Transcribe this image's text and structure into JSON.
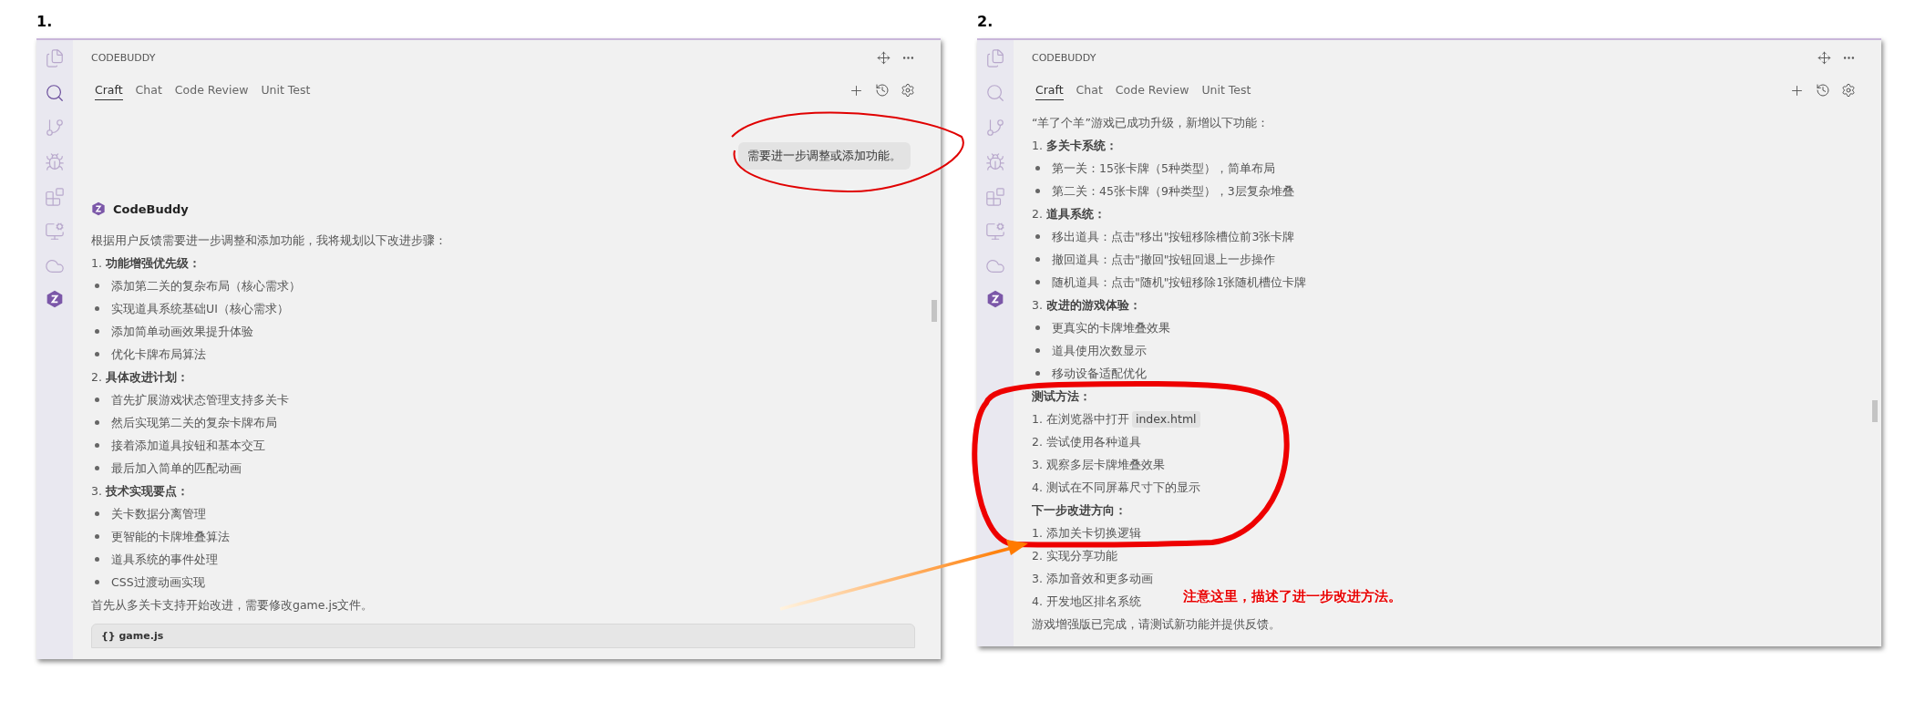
{
  "panels": [
    {
      "label": "1.",
      "header": "CODEBUDDY",
      "tabs": [
        {
          "label": "Craft",
          "selected": true
        },
        {
          "label": "Chat",
          "selected": false
        },
        {
          "label": "Code Review",
          "selected": false
        },
        {
          "label": "Unit Test",
          "selected": false
        }
      ],
      "sidebar": [
        {
          "selected": false
        },
        {
          "selected": true
        },
        {
          "selected": false
        },
        {
          "selected": false
        },
        {
          "selected": false
        },
        {
          "selected": false
        },
        {
          "selected": false
        }
      ],
      "user_message": "需要进一步调整或添加功能。",
      "assistant_name": "CodeBuddy",
      "blocks": [
        {
          "kind": "text",
          "text": "根据用户反馈需要进一步调整和添加功能，我将规划以下改进步骤："
        },
        {
          "kind": "text",
          "text": "1. **功能增强优先级：**"
        },
        {
          "kind": "bullet",
          "text": "添加第二关的复杂布局（核心需求）"
        },
        {
          "kind": "bullet",
          "text": "实现道具系统基础UI（核心需求）"
        },
        {
          "kind": "bullet",
          "text": "添加简单动画效果提升体验"
        },
        {
          "kind": "bullet",
          "text": "优化卡牌布局算法"
        },
        {
          "kind": "text",
          "text": "2. **具体改进计划：**"
        },
        {
          "kind": "bullet",
          "text": "首先扩展游戏状态管理支持多关卡"
        },
        {
          "kind": "bullet",
          "text": "然后实现第二关的复杂卡牌布局"
        },
        {
          "kind": "bullet",
          "text": "接着添加道具按钮和基本交互"
        },
        {
          "kind": "bullet",
          "text": "最后加入简单的匹配动画"
        },
        {
          "kind": "text",
          "text": "3. **技术实现要点：**"
        },
        {
          "kind": "bullet",
          "text": "关卡数据分离管理"
        },
        {
          "kind": "bullet",
          "text": "更智能的卡牌堆叠算法"
        },
        {
          "kind": "bullet",
          "text": "道具系统的事件处理"
        },
        {
          "kind": "bullet",
          "text": "CSS过渡动画实现"
        },
        {
          "kind": "text",
          "text": "首先从多关卡支持开始改进，需要修改game.js文件。"
        },
        {
          "kind": "code_block",
          "text": "{} game.js"
        }
      ]
    },
    {
      "label": "2.",
      "header": "CODEBUDDY",
      "tabs": [
        {
          "label": "Craft",
          "selected": true
        },
        {
          "label": "Chat",
          "selected": false
        },
        {
          "label": "Code Review",
          "selected": false
        },
        {
          "label": "Unit Test",
          "selected": false
        }
      ],
      "sidebar": [
        {
          "selected": false
        },
        {
          "selected": false
        },
        {
          "selected": false
        },
        {
          "selected": false
        },
        {
          "selected": false
        },
        {
          "selected": false
        },
        {
          "selected": false
        }
      ],
      "blocks": [
        {
          "kind": "text",
          "text": "“羊了个羊”游戏已成功升级，新增以下功能："
        },
        {
          "kind": "text",
          "text": "1. **多关卡系统：**"
        },
        {
          "kind": "bullet",
          "text": "第一关：15张卡牌（5种类型），简单布局"
        },
        {
          "kind": "bullet",
          "text": "第二关：45张卡牌（9种类型），3层复杂堆叠"
        },
        {
          "kind": "text",
          "text": "2. **道具系统：**"
        },
        {
          "kind": "bullet",
          "text": "移出道具：点击\"移出\"按钮移除槽位前3张卡牌"
        },
        {
          "kind": "bullet",
          "text": "撤回道具：点击\"撤回\"按钮回退上一步操作"
        },
        {
          "kind": "bullet",
          "text": "随机道具：点击\"随机\"按钮移除1张随机槽位卡牌"
        },
        {
          "kind": "text",
          "text": "3. **改进的游戏体验：**"
        },
        {
          "kind": "bullet",
          "text": "更真实的卡牌堆叠效果"
        },
        {
          "kind": "bullet",
          "text": "道具使用次数显示"
        },
        {
          "kind": "bullet",
          "text": "移动设备适配优化"
        },
        {
          "kind": "heading",
          "text": "测试方法："
        },
        {
          "kind": "text",
          "text": "1. 在浏览器中打开",
          "code": "index.html"
        },
        {
          "kind": "text",
          "text": "2. 尝试使用各种道具"
        },
        {
          "kind": "text",
          "text": "3. 观察多层卡牌堆叠效果"
        },
        {
          "kind": "text",
          "text": "4. 测试在不同屏幕尺寸下的显示"
        },
        {
          "kind": "heading",
          "text": "下一步改进方向："
        },
        {
          "kind": "text",
          "text": "1. 添加关卡切换逻辑"
        },
        {
          "kind": "text",
          "text": "2. 实现分享功能"
        },
        {
          "kind": "text",
          "text": "3. 添加音效和更多动画"
        },
        {
          "kind": "text",
          "text": "4. 开发地区排名系统"
        },
        {
          "kind": "text",
          "text": "游戏增强版已完成，请测试新功能并提供反馈。"
        }
      ]
    }
  ],
  "annotation": {
    "text": "注意这里，描述了进一步改进方法。"
  }
}
